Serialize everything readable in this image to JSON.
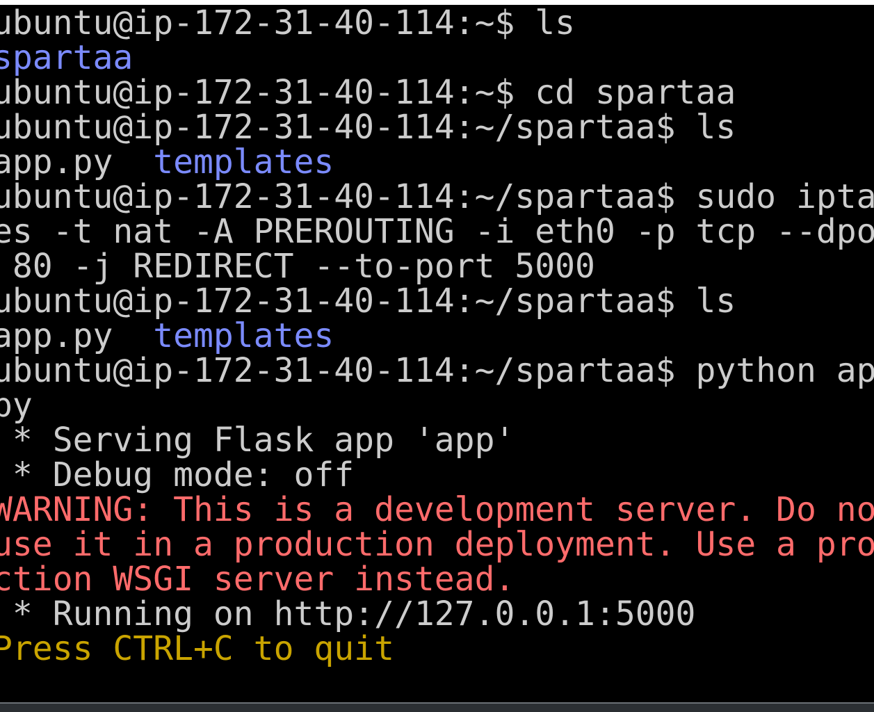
{
  "colors": {
    "background": "#000000",
    "default_text": "#cccccc",
    "directory": "#7b8bff",
    "warning": "#ff6b6b",
    "hint": "#c9a400"
  },
  "terminal": {
    "lines": [
      {
        "segments": [
          {
            "text": "ubuntu@ip-172-31-40-114:~$ ls",
            "color": "#cccccc"
          }
        ]
      },
      {
        "segments": [
          {
            "text": "spartaa",
            "color": "#7b8bff"
          }
        ]
      },
      {
        "segments": [
          {
            "text": "ubuntu@ip-172-31-40-114:~$ cd spartaa",
            "color": "#cccccc"
          }
        ]
      },
      {
        "segments": [
          {
            "text": "ubuntu@ip-172-31-40-114:~/spartaa$ ls",
            "color": "#cccccc"
          }
        ]
      },
      {
        "segments": [
          {
            "text": "app.py  ",
            "color": "#cccccc"
          },
          {
            "text": "templates",
            "color": "#7b8bff"
          }
        ]
      },
      {
        "segments": [
          {
            "text": "ubuntu@ip-172-31-40-114:~/spartaa$ sudo ipta",
            "color": "#cccccc"
          }
        ]
      },
      {
        "segments": [
          {
            "text": "es -t nat -A PREROUTING -i eth0 -p tcp --dpo",
            "color": "#cccccc"
          }
        ]
      },
      {
        "segments": [
          {
            "text": " 80 -j REDIRECT --to-port 5000",
            "color": "#cccccc"
          }
        ]
      },
      {
        "segments": [
          {
            "text": "ubuntu@ip-172-31-40-114:~/spartaa$ ls",
            "color": "#cccccc"
          }
        ]
      },
      {
        "segments": [
          {
            "text": "app.py  ",
            "color": "#cccccc"
          },
          {
            "text": "templates",
            "color": "#7b8bff"
          }
        ]
      },
      {
        "segments": [
          {
            "text": "ubuntu@ip-172-31-40-114:~/spartaa$ python ap",
            "color": "#cccccc"
          }
        ]
      },
      {
        "segments": [
          {
            "text": "py",
            "color": "#cccccc"
          }
        ]
      },
      {
        "segments": [
          {
            "text": " * Serving Flask app 'app'",
            "color": "#cccccc"
          }
        ]
      },
      {
        "segments": [
          {
            "text": " * Debug mode: off",
            "color": "#cccccc"
          }
        ]
      },
      {
        "segments": [
          {
            "text": "WARNING: This is a development server. Do no",
            "color": "#ff6b6b"
          }
        ]
      },
      {
        "segments": [
          {
            "text": "use it in a production deployment. Use a pro",
            "color": "#ff6b6b"
          }
        ]
      },
      {
        "segments": [
          {
            "text": "ction WSGI server instead.",
            "color": "#ff6b6b"
          }
        ]
      },
      {
        "segments": [
          {
            "text": " * Running on http://127.0.0.1:5000",
            "color": "#cccccc"
          }
        ]
      },
      {
        "segments": [
          {
            "text": "Press CTRL+C to quit",
            "color": "#c9a400"
          }
        ]
      }
    ]
  }
}
